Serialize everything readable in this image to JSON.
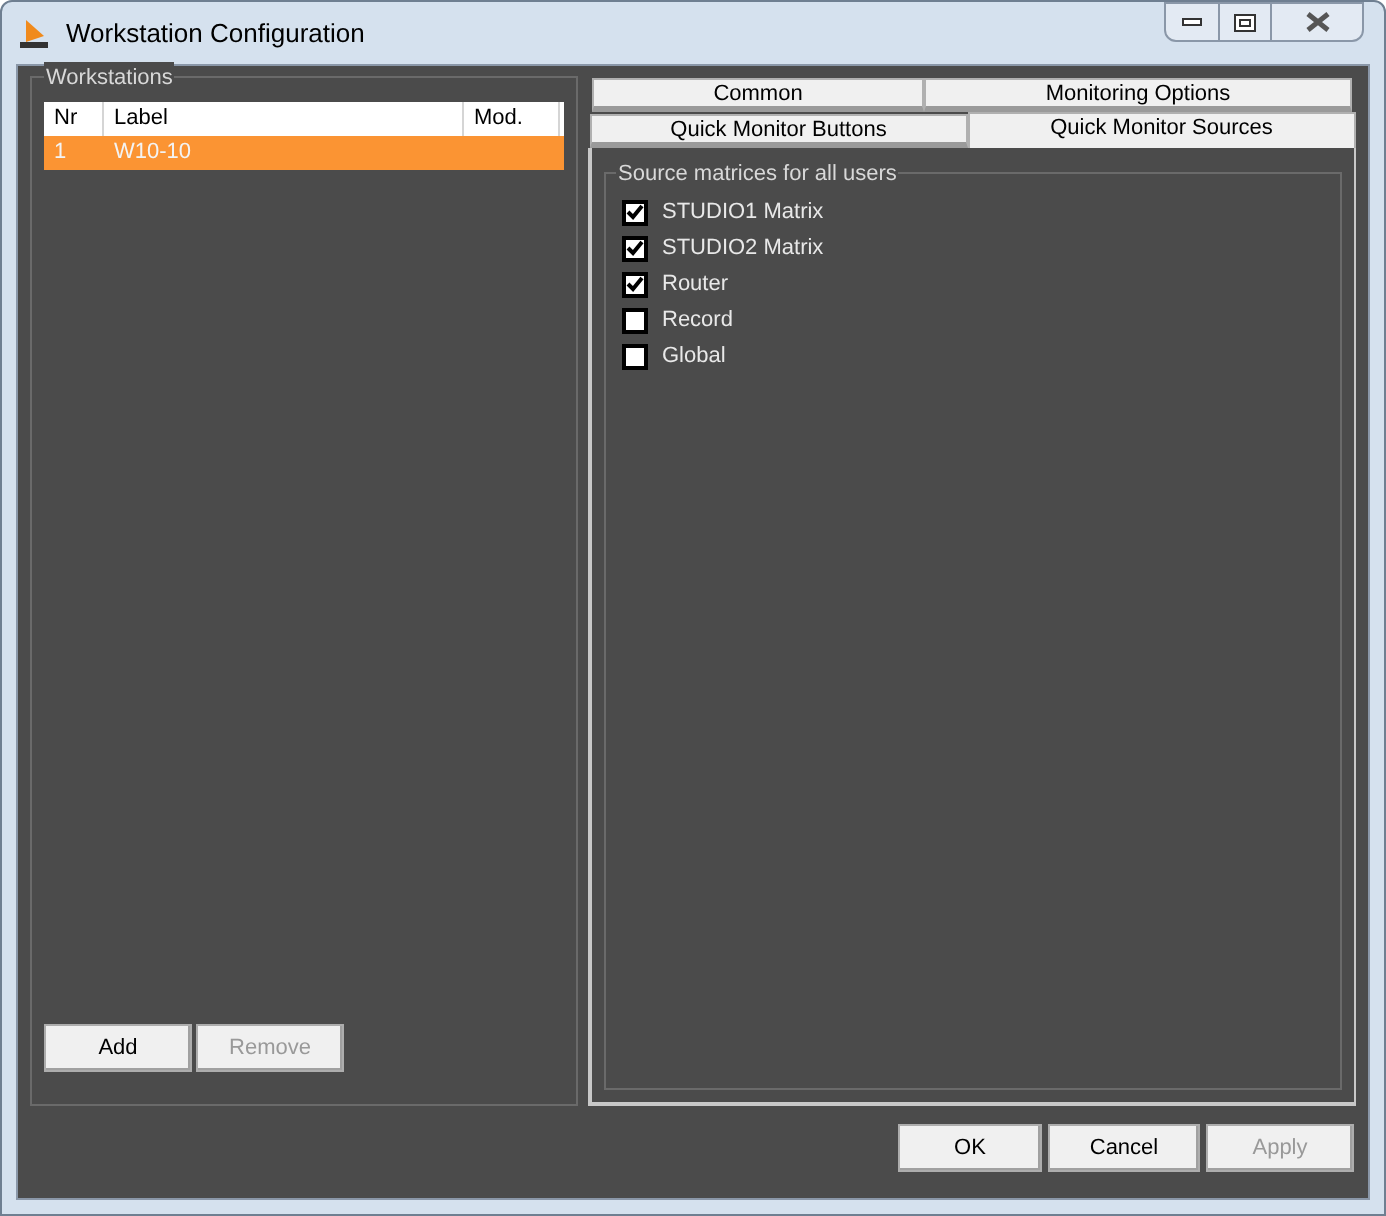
{
  "window": {
    "title": "Workstation Configuration"
  },
  "workstations": {
    "title": "Workstations",
    "columns": [
      "Nr",
      "Label",
      "Mod."
    ],
    "rows": [
      {
        "cells": [
          "1",
          "W10-10"
        ],
        "selected": true
      }
    ],
    "buttons": [
      {
        "label": "Add",
        "disabled": false
      },
      {
        "label": "Remove",
        "disabled": true
      }
    ]
  },
  "tab_rows": [
    {
      "tabs": [
        {
          "label": "Common",
          "selected": false
        },
        {
          "label": "Monitoring Options",
          "selected": false
        }
      ]
    },
    {
      "tabs": [
        {
          "label": "Quick Monitor Buttons",
          "selected": false
        },
        {
          "label": "Quick Monitor Sources",
          "selected": true
        }
      ]
    }
  ],
  "sources": {
    "title": "Source matrices for all users",
    "items": [
      {
        "label": "STUDIO1 Matrix",
        "checked": true
      },
      {
        "label": "STUDIO2 Matrix",
        "checked": true
      },
      {
        "label": "Router",
        "checked": true
      },
      {
        "label": "Record",
        "checked": false
      },
      {
        "label": "Global",
        "checked": false
      }
    ]
  },
  "buttons": [
    {
      "label": "OK",
      "disabled": false
    },
    {
      "label": "Cancel",
      "disabled": false
    },
    {
      "label": "Apply",
      "disabled": true
    }
  ]
}
